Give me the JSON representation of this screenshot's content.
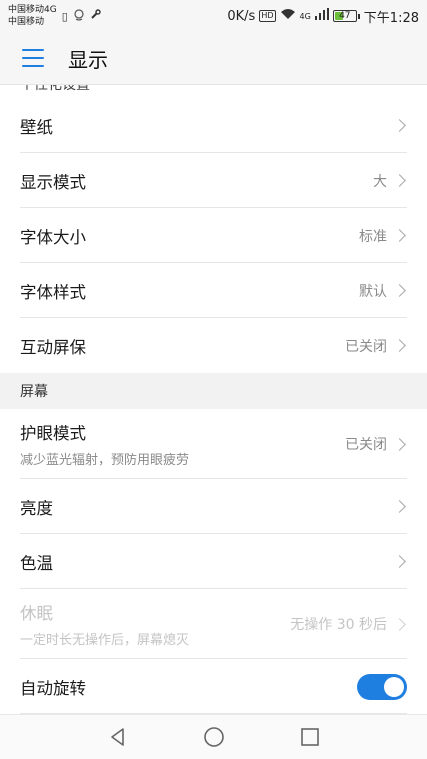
{
  "status_bar": {
    "carrier_line1": "中国移动4G",
    "carrier_line2": "中国移动",
    "speed": "0K/s",
    "hd": "HD",
    "network": "4G",
    "battery": "47",
    "battery_level": 0.47,
    "time": "下午1:28"
  },
  "app_bar": {
    "title": "显示"
  },
  "clipped_section_header": "个性化设置",
  "groups": {
    "personal": [
      {
        "title": "壁纸",
        "value": ""
      },
      {
        "title": "显示模式",
        "value": "大"
      },
      {
        "title": "字体大小",
        "value": "标准"
      },
      {
        "title": "字体样式",
        "value": "默认"
      },
      {
        "title": "互动屏保",
        "value": "已关闭"
      }
    ],
    "screen_header": "屏幕",
    "screen": [
      {
        "title": "护眼模式",
        "subtitle": "减少蓝光辐射，预防用眼疲劳",
        "value": "已关闭"
      },
      {
        "title": "亮度",
        "value": ""
      },
      {
        "title": "色温",
        "value": ""
      },
      {
        "title": "休眠",
        "subtitle": "一定时长无操作后，屏幕熄灭",
        "value": "无操作 30 秒后",
        "disabled": true
      },
      {
        "title": "自动旋转",
        "toggle": true
      }
    ]
  },
  "colors": {
    "accent": "#1f7fe0",
    "battery": "#6bbf3a"
  },
  "icons": {
    "menu": "menu-icon",
    "back": "back-triangle-icon",
    "home": "home-circle-icon",
    "recents": "recents-square-icon"
  }
}
